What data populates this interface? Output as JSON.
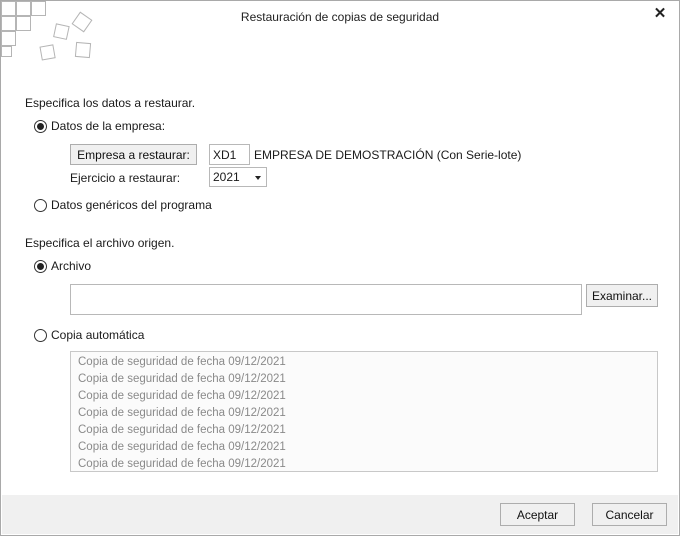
{
  "window": {
    "title": "Restauración de copias de seguridad"
  },
  "data_section": {
    "heading": "Especifica los datos a restaurar.",
    "option_company": "Datos de la empresa:",
    "company_button": "Empresa a restaurar:",
    "company_code": "XD1",
    "company_name": "EMPRESA DE DEMOSTRACIÓN (Con Serie-lote)",
    "year_label": "Ejercicio a restaurar:",
    "year_value": "2021",
    "option_generic": "Datos genéricos del programa"
  },
  "source_section": {
    "heading": "Especifica el archivo origen.",
    "option_file": "Archivo",
    "file_path": "",
    "browse_button": "Examinar...",
    "option_auto": "Copia automática",
    "backups": [
      "Copia de seguridad de fecha 09/12/2021",
      "Copia de seguridad de fecha 09/12/2021",
      "Copia de seguridad de fecha 09/12/2021",
      "Copia de seguridad de fecha 09/12/2021",
      "Copia de seguridad de fecha 09/12/2021",
      "Copia de seguridad de fecha 09/12/2021",
      "Copia de seguridad de fecha 09/12/2021"
    ]
  },
  "footer": {
    "accept": "Aceptar",
    "cancel": "Cancelar"
  }
}
